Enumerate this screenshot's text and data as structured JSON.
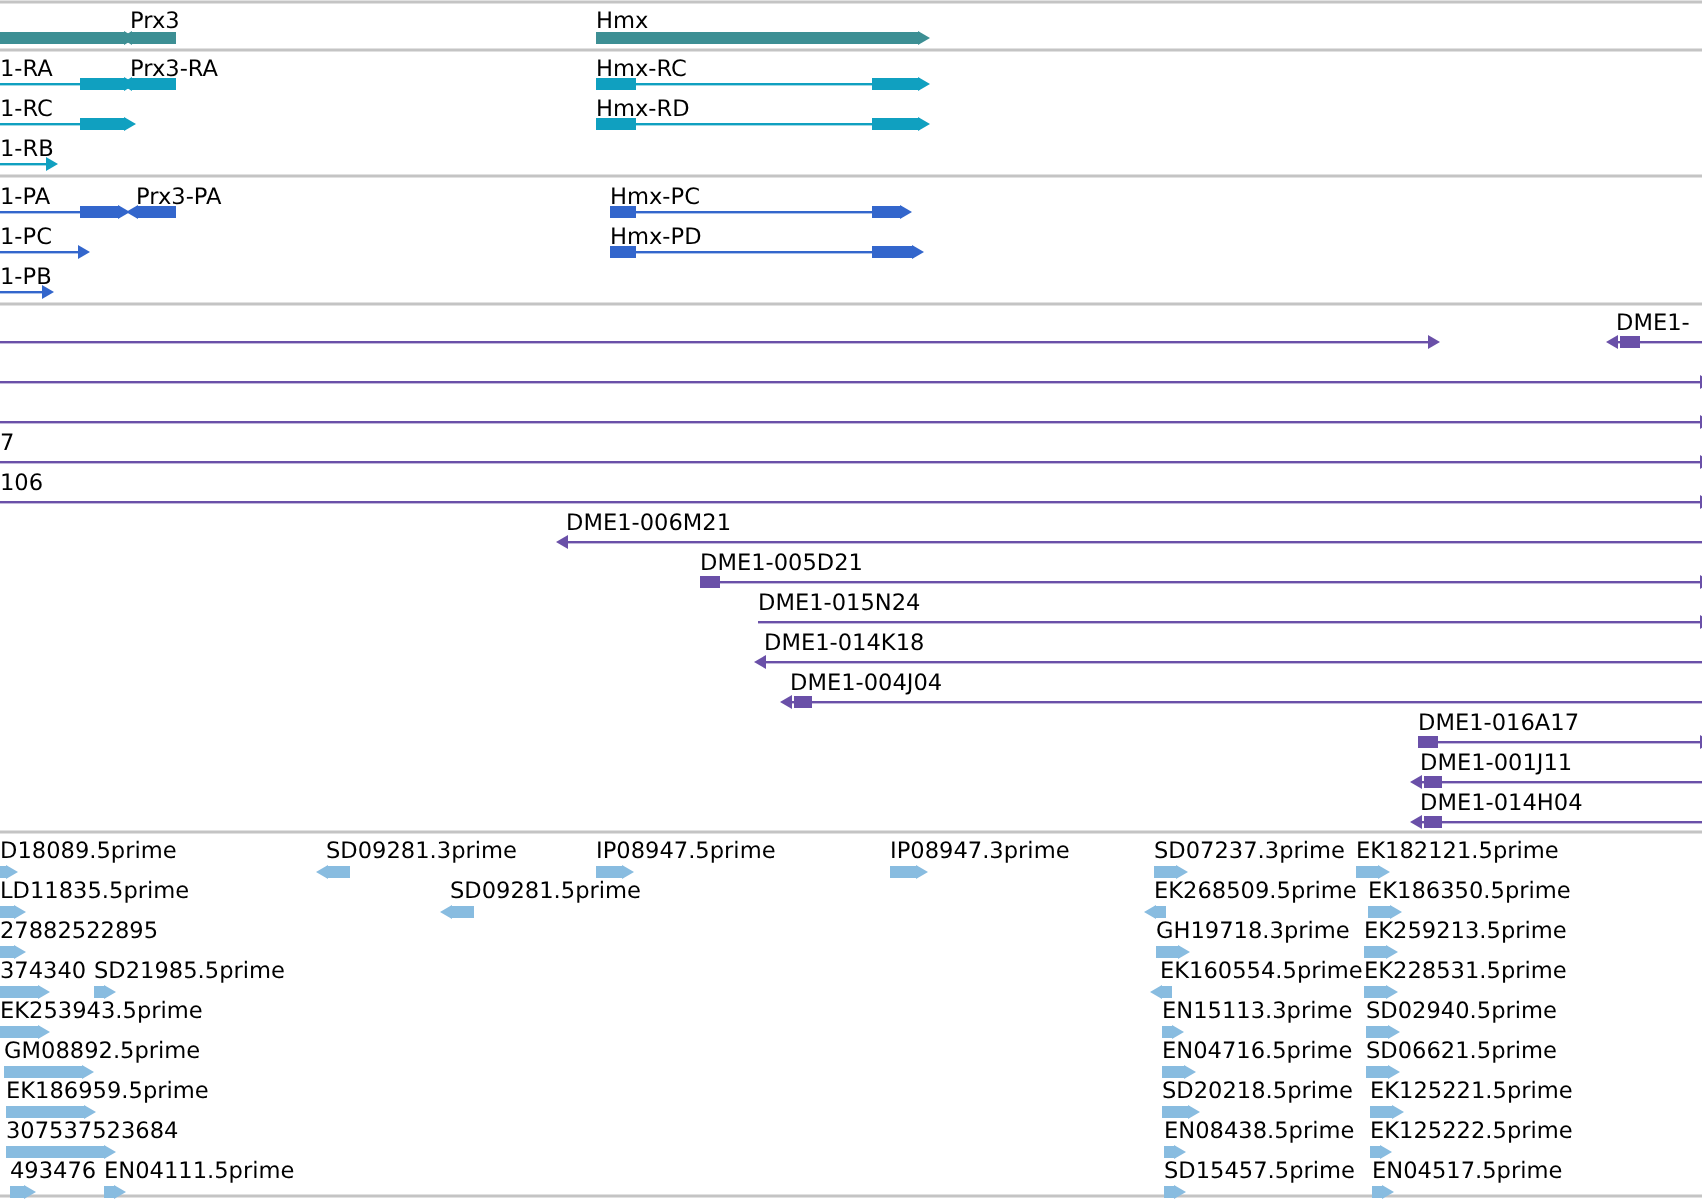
{
  "tracks": [
    {
      "kind": "gene",
      "color": "#3d8f94",
      "features": [
        {
          "reverse": false
        },
        {
          "label": "Prx3",
          "reverse": true
        },
        {
          "label": "Hmx",
          "reverse": false
        }
      ]
    },
    {
      "kind": "transcript",
      "color": "#10a0c0",
      "features": [
        {
          "label": "1-RA",
          "reverse": false
        },
        {
          "label": "Prx3-RA",
          "reverse": true
        },
        {
          "label": "Hmx-RC",
          "reverse": false
        },
        {
          "label": "1-RC",
          "reverse": false
        },
        {
          "label": "Hmx-RD",
          "reverse": false
        },
        {
          "label": "1-RB",
          "reverse": false
        }
      ]
    },
    {
      "kind": "protein",
      "color": "#3366cc",
      "features": [
        {
          "label": "1-PA",
          "reverse": false
        },
        {
          "label": "Prx3-PA",
          "reverse": true
        },
        {
          "label": "Hmx-PC",
          "reverse": false
        },
        {
          "label": "1-PC",
          "reverse": false
        },
        {
          "label": "Hmx-PD",
          "reverse": false
        },
        {
          "label": "1-PB",
          "reverse": false
        }
      ]
    },
    {
      "kind": "clone",
      "color": "#6a50a8",
      "features": [
        {
          "reverse": false
        },
        {
          "label": "DME1-",
          "reverse": true
        },
        {
          "reverse": false
        },
        {
          "reverse": false
        },
        {
          "label": "7",
          "reverse": false
        },
        {
          "label": "106",
          "reverse": false
        },
        {
          "label": "DME1-006M21",
          "reverse": true
        },
        {
          "label": "DME1-005D21",
          "reverse": false
        },
        {
          "label": "DME1-015N24",
          "reverse": false
        },
        {
          "label": "DME1-014K18",
          "reverse": true
        },
        {
          "label": "DME1-004J04",
          "reverse": true
        },
        {
          "label": "DME1-016A17",
          "reverse": false
        },
        {
          "label": "DME1-001J11",
          "reverse": true
        },
        {
          "label": "DME1-014H04",
          "reverse": true
        }
      ]
    },
    {
      "kind": "est",
      "color": "#88bce0",
      "features": [
        {
          "label": "D18089.5prime",
          "reverse": false
        },
        {
          "label": "SD09281.3prime",
          "reverse": true
        },
        {
          "label": "IP08947.5prime",
          "reverse": false
        },
        {
          "label": "IP08947.3prime",
          "reverse": false
        },
        {
          "label": "SD07237.3prime",
          "reverse": false
        },
        {
          "label": "EK182121.5prime",
          "reverse": false
        },
        {
          "label": "LD11835.5prime",
          "reverse": false
        },
        {
          "label": "SD09281.5prime",
          "reverse": true
        },
        {
          "label": "EK268509.5prime",
          "reverse": true
        },
        {
          "label": "EK186350.5prime",
          "reverse": false
        },
        {
          "label": "27882522895",
          "reverse": false
        },
        {
          "label": "GH19718.3prime",
          "reverse": false
        },
        {
          "label": "EK259213.5prime",
          "reverse": false
        },
        {
          "label": "374340",
          "reverse": false
        },
        {
          "label": "SD21985.5prime",
          "reverse": false
        },
        {
          "label": "EK160554.5prime",
          "reverse": true
        },
        {
          "label": "EK228531.5prime",
          "reverse": false
        },
        {
          "label": "EK253943.5prime",
          "reverse": false
        },
        {
          "label": "EN15113.3prime",
          "reverse": false
        },
        {
          "label": "SD02940.5prime",
          "reverse": false
        },
        {
          "label": "GM08892.5prime",
          "reverse": false
        },
        {
          "label": "EN04716.5prime",
          "reverse": false
        },
        {
          "label": "SD06621.5prime",
          "reverse": false
        },
        {
          "label": "EK186959.5prime",
          "reverse": false
        },
        {
          "label": "SD20218.5prime",
          "reverse": false
        },
        {
          "label": "EK125221.5prime",
          "reverse": false
        },
        {
          "label": "307537523684",
          "reverse": false
        },
        {
          "label": "EN08438.5prime",
          "reverse": false
        },
        {
          "label": "EK125222.5prime",
          "reverse": false
        },
        {
          "label": "493476",
          "reverse": false
        },
        {
          "label": "EN04111.5prime",
          "reverse": false
        },
        {
          "label": "SD15457.5prime",
          "reverse": false
        },
        {
          "label": "EN04517.5prime",
          "reverse": false
        }
      ]
    }
  ]
}
